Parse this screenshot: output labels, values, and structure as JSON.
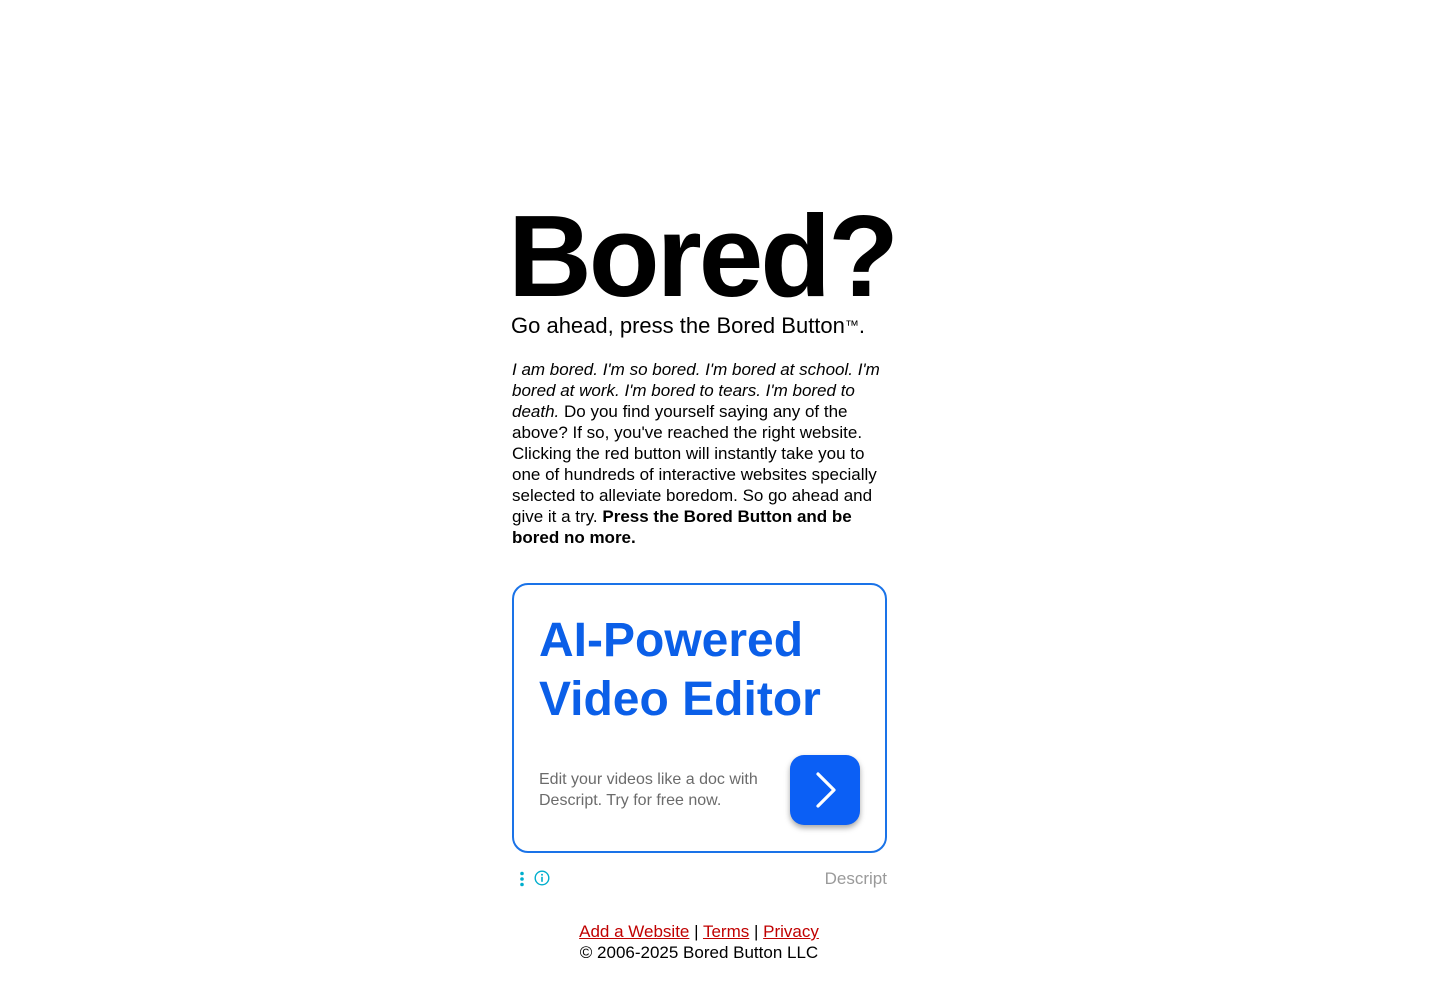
{
  "header": {
    "title": "Bored?",
    "tagline_text": "Go ahead, press the Bored Button",
    "tagline_tm": "™",
    "tagline_end": "."
  },
  "description": {
    "italic": "I am bored. I'm so bored. I'm bored at school. I'm bored at work. I'm bored to tears. I'm bored to death.",
    "normal": " Do you find yourself saying any of the above? If so, you've reached the right website. Clicking the red button will instantly take you to one of hundreds of interactive websites specially selected to alleviate boredom. So go ahead and give it a try. ",
    "bold": "Press the Bored Button and be bored no more."
  },
  "ad": {
    "headline_line1": "AI-Powered",
    "headline_line2": "Video Editor",
    "body": "Edit your videos like a doc with Descript. Try for free now.",
    "cta_icon": "chevron-right-icon",
    "advertiser": "Descript",
    "colors": {
      "border": "#1a73e8",
      "headline": "#0b5fe8",
      "cta": "#0b5ff5"
    }
  },
  "footer": {
    "links": [
      "Add a Website",
      "Terms",
      "Privacy"
    ],
    "separator": "|",
    "copyright": "© 2006-2025 Bored Button LLC",
    "link_color": "#c00000"
  }
}
